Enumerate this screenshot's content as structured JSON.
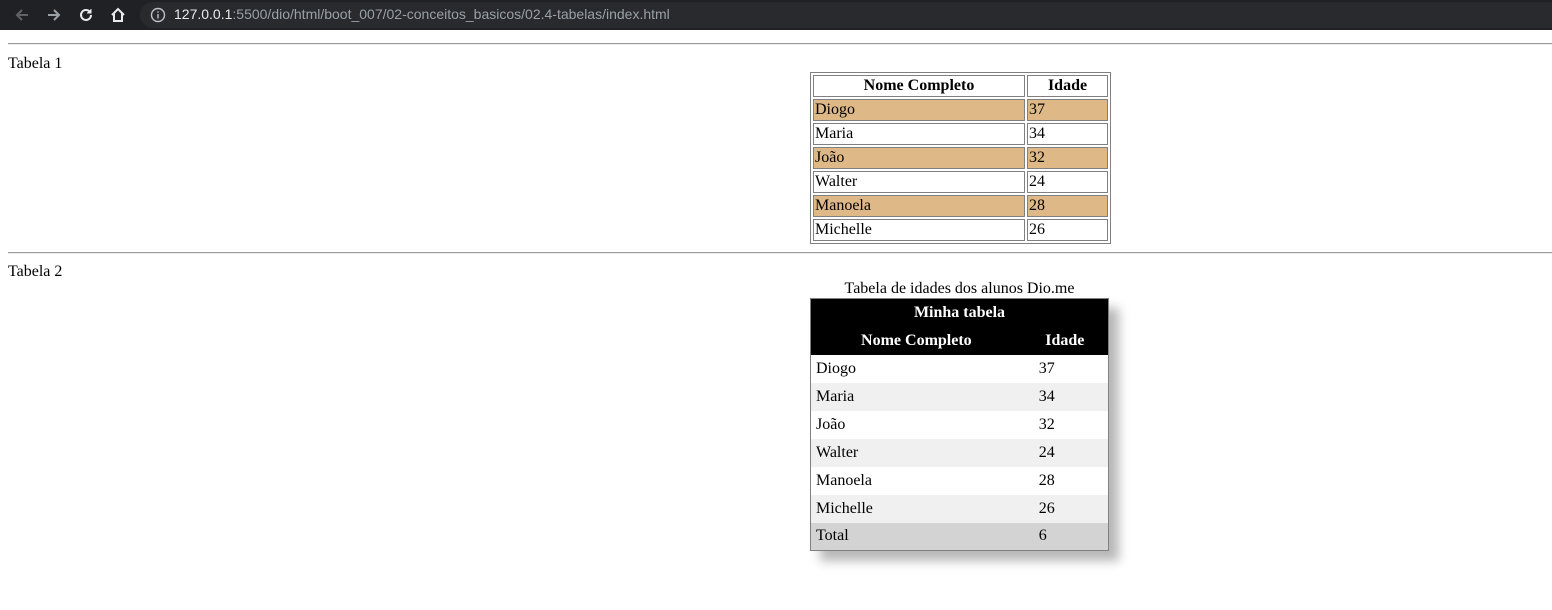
{
  "browser": {
    "url_host": "127.0.0.1",
    "url_rest": ":5500/dio/html/boot_007/02-conceitos_basicos/02.4-tabelas/index.html",
    "icons": [
      "back-arrow-icon",
      "forward-arrow-icon",
      "reload-icon",
      "home-icon",
      "info-icon"
    ]
  },
  "table1": {
    "label": "Tabela 1",
    "headers": [
      "Nome Completo",
      "Idade"
    ],
    "highlight_color": "#deb887",
    "rows": [
      {
        "name": "Diogo",
        "age": "37"
      },
      {
        "name": "Maria",
        "age": "34"
      },
      {
        "name": "João",
        "age": "32"
      },
      {
        "name": "Walter",
        "age": "24"
      },
      {
        "name": "Manoela",
        "age": "28"
      },
      {
        "name": "Michelle",
        "age": "26"
      }
    ]
  },
  "table2": {
    "label": "Tabela 2",
    "caption": "Tabela de idades dos alunos Dio.me",
    "title": "Minha tabela",
    "headers": [
      "Nome Completo",
      "Idade"
    ],
    "rows": [
      {
        "name": "Diogo",
        "age": "37"
      },
      {
        "name": "Maria",
        "age": "34"
      },
      {
        "name": "João",
        "age": "32"
      },
      {
        "name": "Walter",
        "age": "24"
      },
      {
        "name": "Manoela",
        "age": "28"
      },
      {
        "name": "Michelle",
        "age": "26"
      }
    ],
    "footer": {
      "label": "Total",
      "value": "6"
    }
  }
}
